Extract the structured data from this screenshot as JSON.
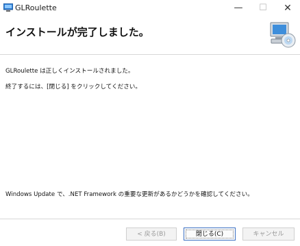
{
  "window": {
    "title": "GLRoulette"
  },
  "title_controls": {
    "minimize": "—",
    "maximize": "☐",
    "close": "✕"
  },
  "header": {
    "headline": "インストールが完了しました。"
  },
  "body": {
    "line1": "GLRoulette は正しくインストールされました。",
    "line2": "終了するには、[閉じる] をクリックしてください。",
    "update_note": "Windows Update で、.NET Framework の重要な更新があるかどうかを確認してください。"
  },
  "buttons": {
    "back": "< 戻る(B)",
    "close": "閉じる(C)",
    "cancel": "キャンセル"
  },
  "icons": {
    "app": "installer-app-icon",
    "header": "computer-disc-icon"
  },
  "colors": {
    "focus_border": "#3b6fc2",
    "disabled_text": "#999999",
    "separator": "#d7d7d7"
  }
}
